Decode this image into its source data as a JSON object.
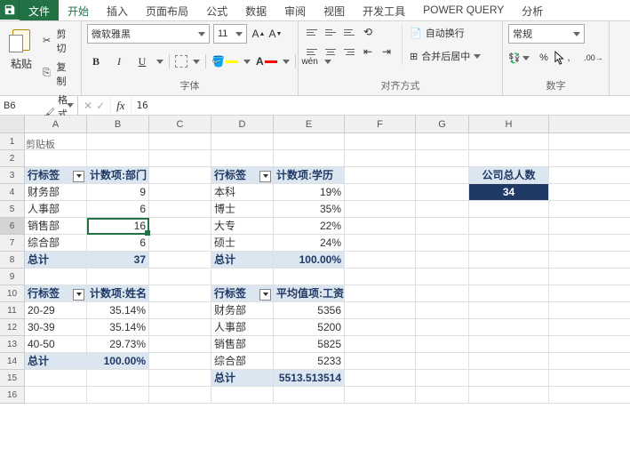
{
  "tabs": {
    "file": "文件",
    "home": "开始",
    "insert": "插入",
    "layout": "页面布局",
    "formula": "公式",
    "data": "数据",
    "review": "审阅",
    "view": "视图",
    "dev": "开发工具",
    "pq": "POWER QUERY",
    "analyze": "分析"
  },
  "ribbon": {
    "clipboard": {
      "paste": "粘贴",
      "cut": "剪切",
      "copy": "复制",
      "painter": "格式刷",
      "label": "剪贴板"
    },
    "font": {
      "name": "微软雅黑",
      "size": "11",
      "label": "字体",
      "wen": "wén"
    },
    "align": {
      "wrap": "自动换行",
      "merge": "合并后居中",
      "label": "对齐方式"
    },
    "number": {
      "format": "常规",
      "label": "数字"
    }
  },
  "namebox": "B6",
  "formula": "16",
  "cols": [
    "A",
    "B",
    "C",
    "D",
    "E",
    "F",
    "G",
    "H"
  ],
  "pivot1": {
    "hdr1": "行标签",
    "hdr2": "计数项:部门",
    "rows": [
      {
        "label": "财务部",
        "val": "9"
      },
      {
        "label": "人事部",
        "val": "6"
      },
      {
        "label": "销售部",
        "val": "16"
      },
      {
        "label": "综合部",
        "val": "6"
      }
    ],
    "total_label": "总计",
    "total_val": "37"
  },
  "pivot2": {
    "hdr1": "行标签",
    "hdr2": "计数项:学历",
    "rows": [
      {
        "label": "本科",
        "val": "19%"
      },
      {
        "label": "博士",
        "val": "35%"
      },
      {
        "label": "大专",
        "val": "22%"
      },
      {
        "label": "硕士",
        "val": "24%"
      }
    ],
    "total_label": "总计",
    "total_val": "100.00%"
  },
  "pivot3": {
    "hdr1": "行标签",
    "hdr2": "计数项:姓名",
    "rows": [
      {
        "label": "20-29",
        "val": "35.14%"
      },
      {
        "label": "30-39",
        "val": "35.14%"
      },
      {
        "label": "40-50",
        "val": "29.73%"
      }
    ],
    "total_label": "总计",
    "total_val": "100.00%"
  },
  "pivot4": {
    "hdr1": "行标签",
    "hdr2": "平均值项:工资",
    "rows": [
      {
        "label": "财务部",
        "val": "5356"
      },
      {
        "label": "人事部",
        "val": "5200"
      },
      {
        "label": "销售部",
        "val": "5825"
      },
      {
        "label": "综合部",
        "val": "5233"
      }
    ],
    "total_label": "总计",
    "total_val": "5513.513514"
  },
  "company": {
    "hdr": "公司总人数",
    "val": "34"
  }
}
